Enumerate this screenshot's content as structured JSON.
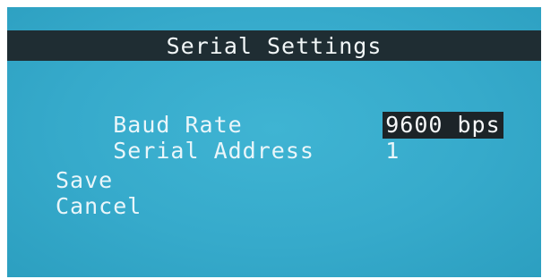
{
  "header": {
    "title": "Serial Settings"
  },
  "settings": [
    {
      "label": "Baud Rate",
      "value": "9600 bps",
      "selected": true
    },
    {
      "label": "Serial Address",
      "value": "1",
      "selected": false
    }
  ],
  "actions": {
    "save_label": "Save",
    "cancel_label": "Cancel"
  },
  "colors": {
    "screen_background": "#36aacb",
    "title_bar": "#1f2d33",
    "text": "#eaf6fa",
    "highlight": "#1c2428"
  }
}
